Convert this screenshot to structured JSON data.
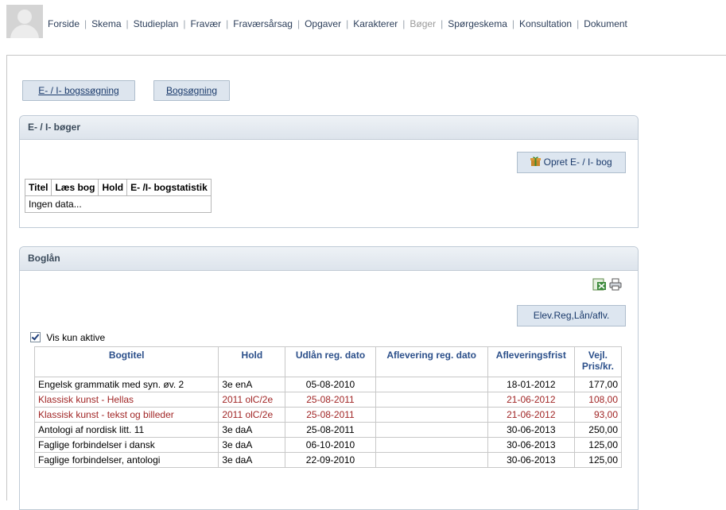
{
  "nav": {
    "items": [
      {
        "label": "Forside",
        "active": false
      },
      {
        "label": "Skema",
        "active": false
      },
      {
        "label": "Studieplan",
        "active": false
      },
      {
        "label": "Fravær",
        "active": false
      },
      {
        "label": "Fraværsårsag",
        "active": false
      },
      {
        "label": "Opgaver",
        "active": false
      },
      {
        "label": "Karakterer",
        "active": false
      },
      {
        "label": "Bøger",
        "active": true
      },
      {
        "label": "Spørgeskema",
        "active": false
      },
      {
        "label": "Konsultation",
        "active": false
      },
      {
        "label": "Dokument",
        "active": false
      }
    ]
  },
  "tabs": {
    "ebook_search": "E- / I- bogssøgning",
    "book_search": "Bogsøgning"
  },
  "ebooks": {
    "title": "E- / I- bøger",
    "create_button": "Opret E- / I- bog",
    "columns": [
      "Titel",
      "Læs bog",
      "Hold",
      "E- /I- bogstatistik"
    ],
    "empty_text": "Ingen data..."
  },
  "loans": {
    "title": "Boglån",
    "register_button": "Elev.Reg,Lån/aflv.",
    "only_active_label": "Vis kun aktive",
    "columns": [
      "Bogtitel",
      "Hold",
      "Udlån reg. dato",
      "Aflevering reg. dato",
      "Afleveringsfrist",
      "Vejl. Pris/kr."
    ],
    "rows": [
      {
        "title": "Engelsk grammatik med syn. øv. 2",
        "hold": "3e enA",
        "udlaan": "05-08-2010",
        "aflevering": "",
        "frist": "18-01-2012",
        "pris": "177,00",
        "red": false
      },
      {
        "title": "Klassisk kunst - Hellas",
        "hold": "2011 olC/2e",
        "udlaan": "25-08-2011",
        "aflevering": "",
        "frist": "21-06-2012",
        "pris": "108,00",
        "red": true
      },
      {
        "title": "Klassisk kunst - tekst og billeder",
        "hold": "2011 olC/2e",
        "udlaan": "25-08-2011",
        "aflevering": "",
        "frist": "21-06-2012",
        "pris": "93,00",
        "red": true
      },
      {
        "title": "Antologi af nordisk litt. 11",
        "hold": "3e daA",
        "udlaan": "25-08-2011",
        "aflevering": "",
        "frist": "30-06-2013",
        "pris": "250,00",
        "red": false
      },
      {
        "title": "Faglige forbindelser i dansk",
        "hold": "3e daA",
        "udlaan": "06-10-2010",
        "aflevering": "",
        "frist": "30-06-2013",
        "pris": "125,00",
        "red": false
      },
      {
        "title": "Faglige forbindelser, antologi",
        "hold": "3e daA",
        "udlaan": "22-09-2010",
        "aflevering": "",
        "frist": "30-06-2013",
        "pris": "125,00",
        "red": false
      }
    ]
  },
  "colors": {
    "link": "#2c3e5a",
    "header_text": "#2b4f8a",
    "overdue_red": "#a12626",
    "panel_header_bg": "#dde4ec"
  }
}
